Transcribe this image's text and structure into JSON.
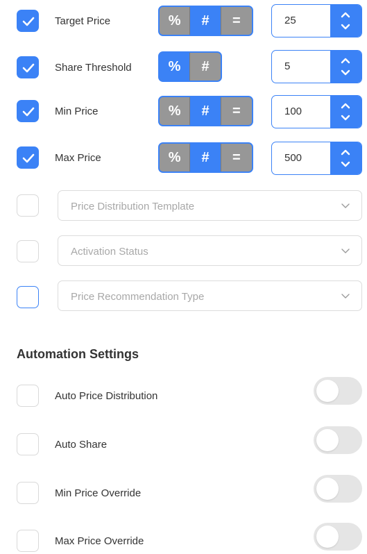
{
  "colors": {
    "accent": "#3b82f6",
    "segment_inactive": "#979797",
    "toggle_off": "#e5e5e5",
    "placeholder": "#a8a8a8"
  },
  "price_rules": [
    {
      "label": "Target Price",
      "checked": true,
      "segments": [
        {
          "symbol": "%",
          "icon": "percent-icon",
          "active": false
        },
        {
          "symbol": "#",
          "icon": "hash-icon",
          "active": true
        },
        {
          "symbol": "=",
          "icon": "equals-icon",
          "active": false
        }
      ],
      "value": "25"
    },
    {
      "label": "Share Threshold",
      "checked": true,
      "segments": [
        {
          "symbol": "%",
          "icon": "percent-icon",
          "active": true
        },
        {
          "symbol": "#",
          "icon": "hash-icon",
          "active": false
        }
      ],
      "value": "5"
    },
    {
      "label": "Min Price",
      "checked": true,
      "segments": [
        {
          "symbol": "%",
          "icon": "percent-icon",
          "active": false
        },
        {
          "symbol": "#",
          "icon": "hash-icon",
          "active": true
        },
        {
          "symbol": "=",
          "icon": "equals-icon",
          "active": false
        }
      ],
      "value": "100"
    },
    {
      "label": "Max Price",
      "checked": true,
      "segments": [
        {
          "symbol": "%",
          "icon": "percent-icon",
          "active": false
        },
        {
          "symbol": "#",
          "icon": "hash-icon",
          "active": true
        },
        {
          "symbol": "=",
          "icon": "equals-icon",
          "active": false
        }
      ],
      "value": "500"
    }
  ],
  "dropdowns": [
    {
      "placeholder": "Price Distribution Template",
      "checked": false
    },
    {
      "placeholder": "Activation Status",
      "checked": false
    },
    {
      "placeholder": "Price Recommendation Type",
      "checked": false,
      "focused": true
    }
  ],
  "automation": {
    "title": "Automation Settings",
    "items": [
      {
        "label": "Auto Price Distribution",
        "checked": false,
        "enabled": false
      },
      {
        "label": "Auto Share",
        "checked": false,
        "enabled": false
      },
      {
        "label": "Min Price Override",
        "checked": false,
        "enabled": false
      },
      {
        "label": "Max Price Override",
        "checked": false,
        "enabled": false
      }
    ]
  }
}
